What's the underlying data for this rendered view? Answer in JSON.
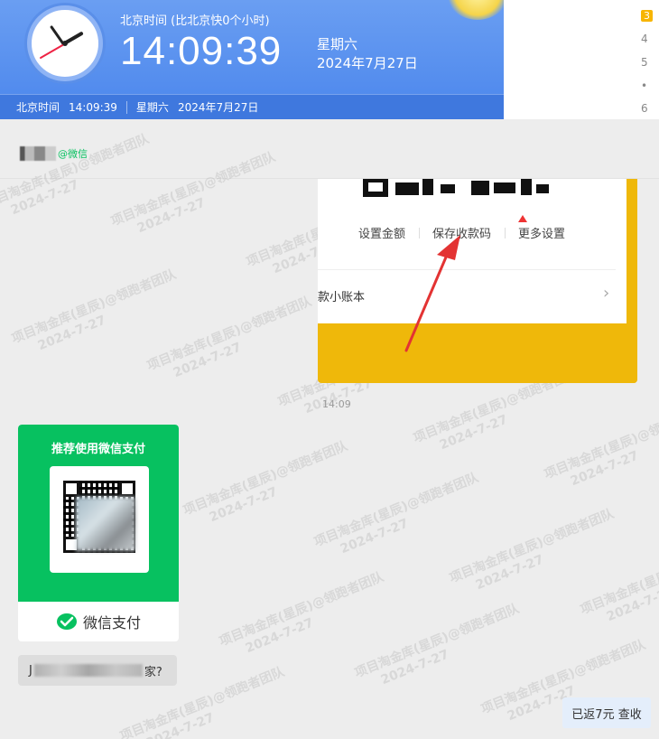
{
  "clock": {
    "subtitle": "北京时间 (比北京快0个小时)",
    "time": "14:09:39",
    "weekday": "星期六",
    "date": "2024年7月27日",
    "bar_label": "北京时间",
    "bar_time": "14:09:39",
    "bar_weekday": "星期六",
    "bar_date": "2024年7月27日"
  },
  "rank_list": [
    "3",
    "4",
    "5",
    "•",
    "6"
  ],
  "chat": {
    "contact_suffix": "@微信",
    "watermark_line1": "项目淘金库(星辰)@领跑者团队",
    "watermark_line2": "2024-7-27"
  },
  "qr_card": {
    "actions": [
      "设置金额",
      "保存收款码",
      "更多设置"
    ],
    "ledger_label": "款小账本",
    "chevron": "›",
    "time": "14:09"
  },
  "wxpay_card": {
    "title": "推荐使用微信支付",
    "footer_label": "微信支付"
  },
  "text_message": {
    "prefix": "J",
    "suffix": "家?"
  },
  "refund_badge": "已返7元 查收",
  "colors": {
    "clock_blue": "#4b86ec",
    "wechat_green": "#07c160",
    "card_yellow": "#efb80a",
    "annotation_red": "#e33333"
  }
}
